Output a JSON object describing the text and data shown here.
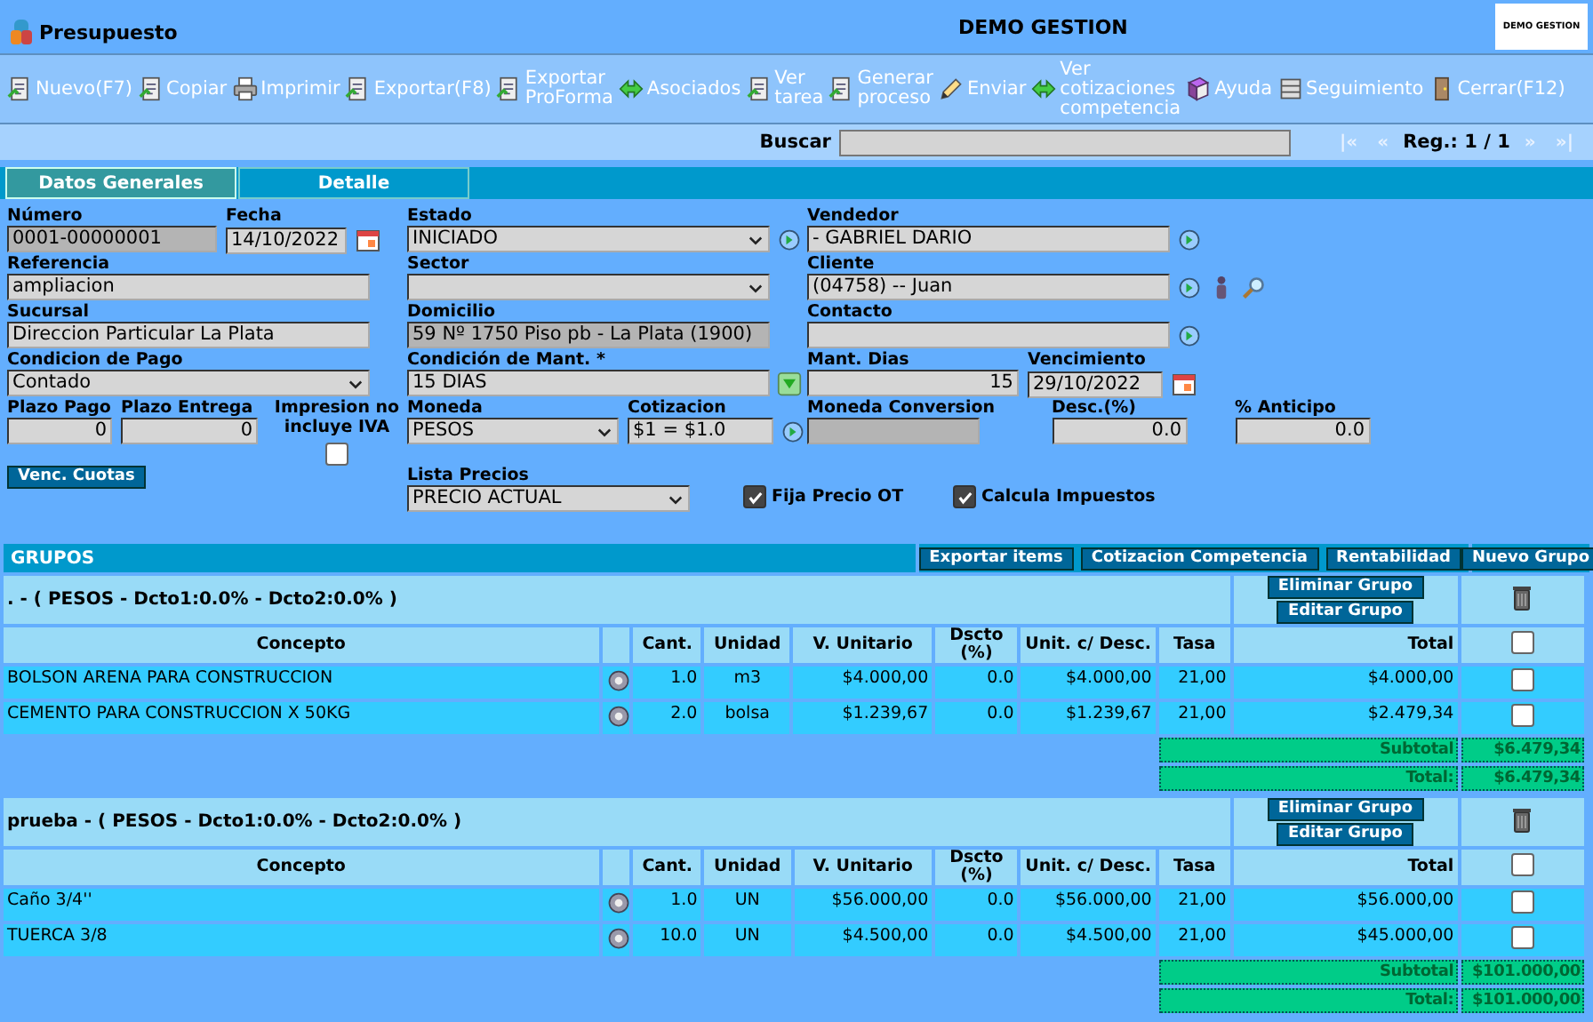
{
  "window": {
    "title": "Presupuesto",
    "app_name": "DEMO GESTION",
    "logo_text": "DEMO GESTION"
  },
  "toolbar": [
    {
      "lines": [
        "Nuevo(F7)"
      ]
    },
    {
      "lines": [
        "Copiar"
      ]
    },
    {
      "lines": [
        "Imprimir"
      ]
    },
    {
      "lines": [
        "Exportar(F8)"
      ]
    },
    {
      "lines": [
        "Exportar",
        "ProForma"
      ]
    },
    {
      "lines": [
        "Asociados"
      ]
    },
    {
      "lines": [
        "Ver",
        "tarea"
      ]
    },
    {
      "lines": [
        "Generar",
        "proceso"
      ]
    },
    {
      "lines": [
        "Enviar"
      ]
    },
    {
      "lines": [
        "Ver",
        "cotizaciones",
        "competencia"
      ]
    },
    {
      "lines": [
        "Ayuda"
      ]
    },
    {
      "lines": [
        "Seguimiento"
      ]
    },
    {
      "lines": [
        "Cerrar(F12)"
      ]
    }
  ],
  "search": {
    "label": "Buscar",
    "record": "Reg.: 1 / 1",
    "nav": [
      {
        "label": "|«",
        "disabled": true
      },
      {
        "label": "«",
        "disabled": true
      },
      {
        "label": "»",
        "disabled": true
      },
      {
        "label": "»|",
        "disabled": true
      }
    ]
  },
  "tabs": [
    {
      "label": "Datos Generales",
      "selected": true
    },
    {
      "label": "Detalle",
      "selected": false
    }
  ],
  "form": {
    "numero": {
      "label": "Número",
      "value": "0001-00000001",
      "disabled": true
    },
    "fecha": {
      "label": "Fecha",
      "value": "14/10/2022",
      "disabled": false
    },
    "estado": {
      "label": "Estado",
      "value": "INICIADO"
    },
    "vendedor": {
      "label": "Vendedor",
      "value": "- GABRIEL DARIO",
      "disabled": false
    },
    "referencia": {
      "label": "Referencia",
      "value": "ampliacion",
      "disabled": false
    },
    "sector": {
      "label": "Sector"
    },
    "cliente": {
      "label": "Cliente",
      "value": "(04758) -- Juan",
      "disabled": false
    },
    "sucursal": {
      "label": "Sucursal",
      "value": "Direccion Particular La Plata",
      "disabled": false
    },
    "domicilio": {
      "label": "Domicilio",
      "value": "59 Nº 1750 Piso pb - La Plata (1900)",
      "disabled": true
    },
    "contacto": {
      "label": "Contacto",
      "disabled": false
    },
    "condicion_pago": {
      "label": "Condicion de Pago",
      "value": "Contado"
    },
    "condicion_mant": {
      "label": "Condición de Mant. *",
      "value": "15 DIAS",
      "disabled": false
    },
    "mant_dias": {
      "label": "Mant. Dias",
      "value": "15",
      "disabled": false
    },
    "vencimiento": {
      "label": "Vencimiento",
      "value": "29/10/2022",
      "disabled": false
    },
    "plazo_pago": {
      "label": "Plazo Pago",
      "value": "0",
      "disabled": false
    },
    "plazo_entrega": {
      "label": "Plazo Entrega",
      "value": "0",
      "disabled": false
    },
    "impresion_iva": {
      "label": "Impresion no incluye IVA",
      "checked": false
    },
    "moneda": {
      "label": "Moneda",
      "value": "PESOS"
    },
    "cotizacion": {
      "label": "Cotizacion",
      "value": "$1 = $1.0",
      "disabled": false
    },
    "moneda_conversion": {
      "label": "Moneda Conversion",
      "disabled": true
    },
    "descuento": {
      "label": "Desc.(%)",
      "value": "0.0",
      "disabled": false
    },
    "anticipo": {
      "label": "% Anticipo",
      "value": "0.0",
      "disabled": false
    },
    "venc_cuotas": {
      "label": "Venc. Cuotas"
    },
    "lista_precios": {
      "label": "Lista Precios",
      "value": "PRECIO ACTUAL"
    },
    "fija_precio": {
      "label": "Fija Precio OT",
      "checked": true
    },
    "calcula_impuestos": {
      "label": "Calcula Impuestos",
      "checked": true
    }
  },
  "groups_section": {
    "title": "GRUPOS",
    "actions": [
      "Exportar items",
      "Cotizacion Competencia",
      "Rentabilidad"
    ],
    "new_group": "Nuevo Grupo",
    "groups": [
      {
        "header": ". - ( PESOS - Dcto1:0.0% - Dcto2:0.0% )",
        "delete_label": "Eliminar Grupo",
        "edit_label": "Editar Grupo",
        "select_all": false,
        "columns": [
          "Concepto",
          "Cant.",
          "Unidad",
          "V. Unitario",
          "Dscto (%)",
          "Unit. c/ Desc.",
          "Tasa",
          "Total"
        ],
        "items": [
          {
            "concepto": "BOLSON ARENA PARA CONSTRUCCION",
            "cant": "1.0",
            "unidad": "m3",
            "v_unitario": "$4.000,00",
            "dscto": "0.0",
            "unit_desc": "$4.000,00",
            "tasa": "21,00",
            "total": "$4.000,00",
            "checked": false
          },
          {
            "concepto": "CEMENTO PARA CONSTRUCCION X 50KG",
            "cant": "2.0",
            "unidad": "bolsa",
            "v_unitario": "$1.239,67",
            "dscto": "0.0",
            "unit_desc": "$1.239,67",
            "tasa": "21,00",
            "total": "$2.479,34",
            "checked": false
          }
        ],
        "subtotal_label": "Subtotal",
        "subtotal": "$6.479,34",
        "total_label": "Total:",
        "total": "$6.479,34"
      },
      {
        "header": "prueba - ( PESOS - Dcto1:0.0% - Dcto2:0.0% )",
        "delete_label": "Eliminar Grupo",
        "edit_label": "Editar Grupo",
        "select_all": false,
        "columns": [
          "Concepto",
          "Cant.",
          "Unidad",
          "V. Unitario",
          "Dscto (%)",
          "Unit. c/ Desc.",
          "Tasa",
          "Total"
        ],
        "items": [
          {
            "concepto": "Caño 3/4''",
            "cant": "1.0",
            "unidad": "UN",
            "v_unitario": "$56.000,00",
            "dscto": "0.0",
            "unit_desc": "$56.000,00",
            "tasa": "21,00",
            "total": "$56.000,00",
            "checked": false
          },
          {
            "concepto": "TUERCA 3/8",
            "cant": "10.0",
            "unidad": "UN",
            "v_unitario": "$4.500,00",
            "dscto": "0.0",
            "unit_desc": "$4.500,00",
            "tasa": "21,00",
            "total": "$45.000,00",
            "checked": false
          }
        ],
        "subtotal_label": "Subtotal",
        "subtotal": "$101.000,00",
        "total_label": "Total:",
        "total": "$101.000,00"
      }
    ]
  }
}
